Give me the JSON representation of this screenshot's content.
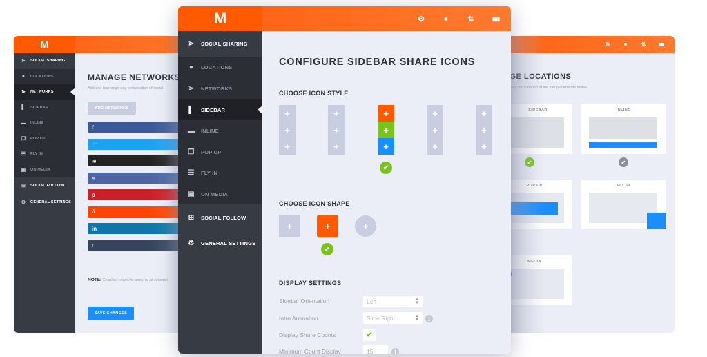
{
  "brand": {
    "logo_letter": "M",
    "accent": "#ff6a1a",
    "sidebar_bg": "#373b44",
    "blue": "#1a8dff",
    "green": "#7ac21c"
  },
  "header_icons": [
    {
      "name": "gear-icon",
      "glyph": "⚙"
    },
    {
      "name": "lock-icon",
      "glyph": "🔒"
    },
    {
      "name": "import-export-icon",
      "glyph": "⇅"
    },
    {
      "name": "stats-icon",
      "glyph": "▮▮▮"
    }
  ],
  "sidebar": {
    "items": [
      {
        "label": "Social Sharing",
        "icon": "share-icon",
        "glyph": "⋗",
        "kind": "top"
      },
      {
        "label": "Locations",
        "icon": "location-pin-icon",
        "glyph": "●",
        "kind": "sub"
      },
      {
        "label": "Networks",
        "icon": "network-icon",
        "glyph": "⋗",
        "kind": "sub"
      },
      {
        "label": "Sidebar",
        "icon": "sidebar-icon",
        "glyph": "▌",
        "kind": "sub"
      },
      {
        "label": "Inline",
        "icon": "inline-icon",
        "glyph": "▬",
        "kind": "sub"
      },
      {
        "label": "Pop Up",
        "icon": "popup-icon",
        "glyph": "❐",
        "kind": "sub"
      },
      {
        "label": "Fly In",
        "icon": "flyin-icon",
        "glyph": "☰",
        "kind": "sub"
      },
      {
        "label": "On Media",
        "icon": "image-icon",
        "glyph": "▣",
        "kind": "sub"
      },
      {
        "label": "Social Follow",
        "icon": "plus-square-icon",
        "glyph": "⊞",
        "kind": "top"
      },
      {
        "label": "General Settings",
        "icon": "gear-icon",
        "glyph": "⚙",
        "kind": "top"
      }
    ]
  },
  "left_panel": {
    "active_item": "Networks",
    "title": "MANAGE NETWORKS",
    "subtitle": "Add and rearrange any combination of social",
    "add_button": "ADD NETWORKS",
    "networks": [
      {
        "name": "facebook",
        "glyph": "f",
        "color": "#3b5998"
      },
      {
        "name": "twitter",
        "glyph": "🐦",
        "color": "#1da1f2"
      },
      {
        "name": "buffer",
        "glyph": "≋",
        "color": "#232323"
      },
      {
        "name": "flipboard",
        "glyph": "fip",
        "color": "#4c66a4"
      },
      {
        "name": "pinterest",
        "glyph": "p",
        "color": "#cb2027"
      },
      {
        "name": "reddit",
        "glyph": "ő",
        "color": "#ff4500"
      },
      {
        "name": "linkedin",
        "glyph": "in",
        "color": "#0e76a8"
      },
      {
        "name": "tumblr",
        "glyph": "t",
        "color": "#35465c"
      }
    ],
    "note_label": "NOTE:",
    "note_text": "Selected networks apply to all selected",
    "save_button": "SAVE CHANGES"
  },
  "middle_panel": {
    "active_item": "Sidebar",
    "title": "CONFIGURE SIDEBAR SHARE ICONS",
    "icon_style": {
      "heading": "CHOOSE ICON STYLE",
      "options": [
        {
          "id": "style-1",
          "selected": false,
          "colors": [
            "#c9cde0",
            "#c9cde0",
            "#c9cde0"
          ]
        },
        {
          "id": "style-2",
          "selected": false,
          "colors": [
            "#c9cde0",
            "#c9cde0",
            "#c9cde0"
          ]
        },
        {
          "id": "style-3",
          "selected": true,
          "colors": [
            "#ff5a00",
            "#7ac21c",
            "#1a8dff"
          ]
        },
        {
          "id": "style-4",
          "selected": false,
          "colors": [
            "#c9cde0",
            "#c9cde0",
            "#c9cde0"
          ]
        },
        {
          "id": "style-5",
          "selected": false,
          "colors": [
            "#c9cde0",
            "#c9cde0",
            "#c9cde0"
          ]
        }
      ],
      "plus": "+"
    },
    "icon_shape": {
      "heading": "CHOOSE ICON SHAPE",
      "options": [
        {
          "id": "square",
          "selected": false
        },
        {
          "id": "rounded",
          "selected": true
        },
        {
          "id": "circle",
          "selected": false
        }
      ]
    },
    "display_settings": {
      "heading": "DISPLAY SETTINGS",
      "rows": [
        {
          "label": "Sidebar Orientation",
          "type": "select",
          "value": "Left"
        },
        {
          "label": "Intro Animation",
          "type": "select",
          "value": "Slide Right",
          "info": true
        },
        {
          "label": "Display Share Counts",
          "type": "checkbox",
          "checked": true
        },
        {
          "label": "Minimum Count Display",
          "type": "number",
          "value": "15",
          "info": true
        }
      ]
    }
  },
  "right_panel": {
    "title": "MANAGE LOCATIONS",
    "title_visible": "AGE LOCATIONS",
    "subtitle": "ect any combination of the five placements below.",
    "locations": [
      {
        "label": "SIDEBAR",
        "enabled": true
      },
      {
        "label": "INLINE",
        "enabled": false
      },
      {
        "label": "POP UP"
      },
      {
        "label": "FLY IN"
      },
      {
        "label": "MEDIA"
      }
    ]
  }
}
